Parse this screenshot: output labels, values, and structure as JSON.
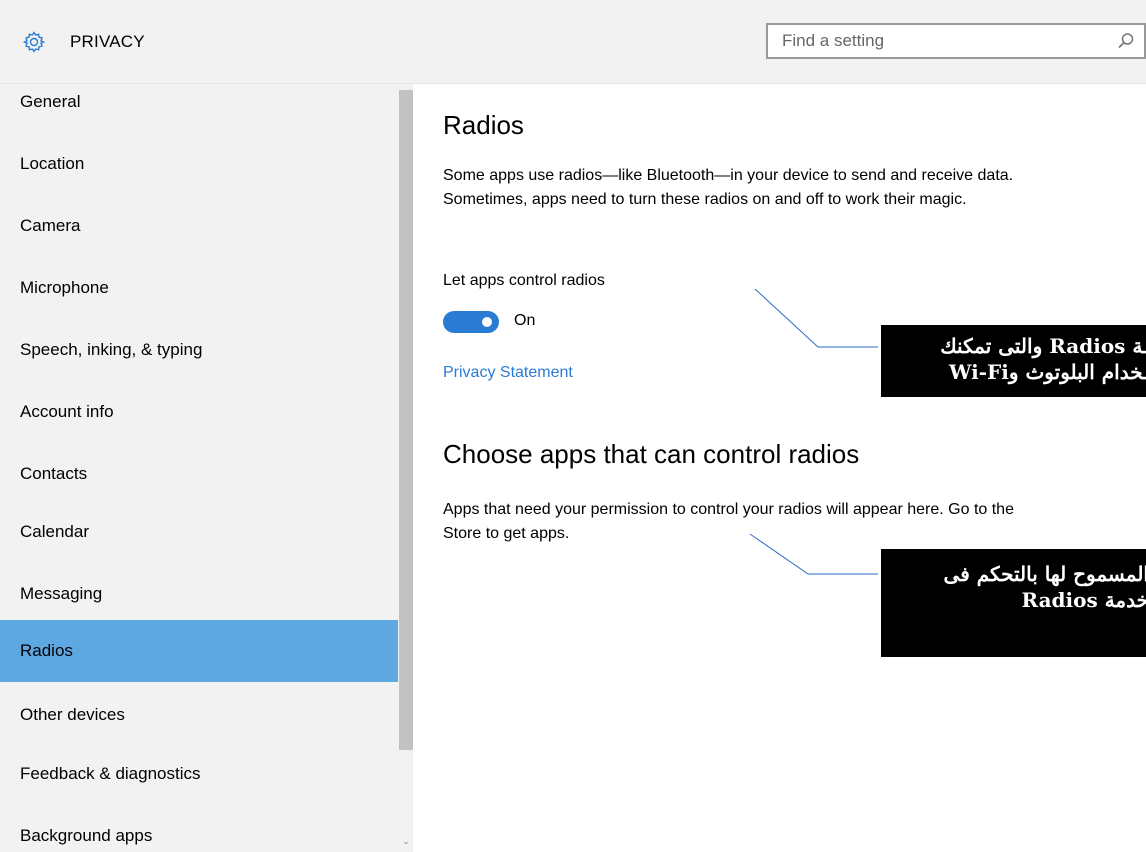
{
  "header": {
    "app_title": "PRIVACY",
    "search_placeholder": "Find a setting"
  },
  "sidebar": {
    "items": [
      {
        "label": "General"
      },
      {
        "label": "Location"
      },
      {
        "label": "Camera"
      },
      {
        "label": "Microphone"
      },
      {
        "label": "Speech, inking, & typing"
      },
      {
        "label": "Account info"
      },
      {
        "label": "Contacts"
      },
      {
        "label": "Calendar"
      },
      {
        "label": "Messaging"
      },
      {
        "label": "Radios",
        "selected": true
      },
      {
        "label": "Other devices"
      },
      {
        "label": "Feedback & diagnostics"
      },
      {
        "label": "Background apps"
      }
    ]
  },
  "main": {
    "title": "Radios",
    "description": "Some apps use radios—like Bluetooth—in your device to send and receive data. Sometimes, apps need to turn these radios on and off to work their magic.",
    "toggle_label": "Let apps control radios",
    "toggle_state": "On",
    "privacy_link": "Privacy Statement",
    "section2_title": "Choose apps that can control radios",
    "section2_description": "Apps that need your permission to control your radios will appear here. Go to the Store to get apps."
  },
  "annotations": {
    "callout1_line1": "ـة Radios والتى تمكنك",
    "callout1_line2": "ـخدام البلوتوث وWi-Fi",
    "callout2_line1": "المسموح لها بالتحكم فى",
    "callout2_line2": "خدمة Radios"
  },
  "colors": {
    "accent": "#2a7bd3",
    "selected_bg": "#5ea8e2",
    "sidebar_bg": "#f2f2f2"
  }
}
